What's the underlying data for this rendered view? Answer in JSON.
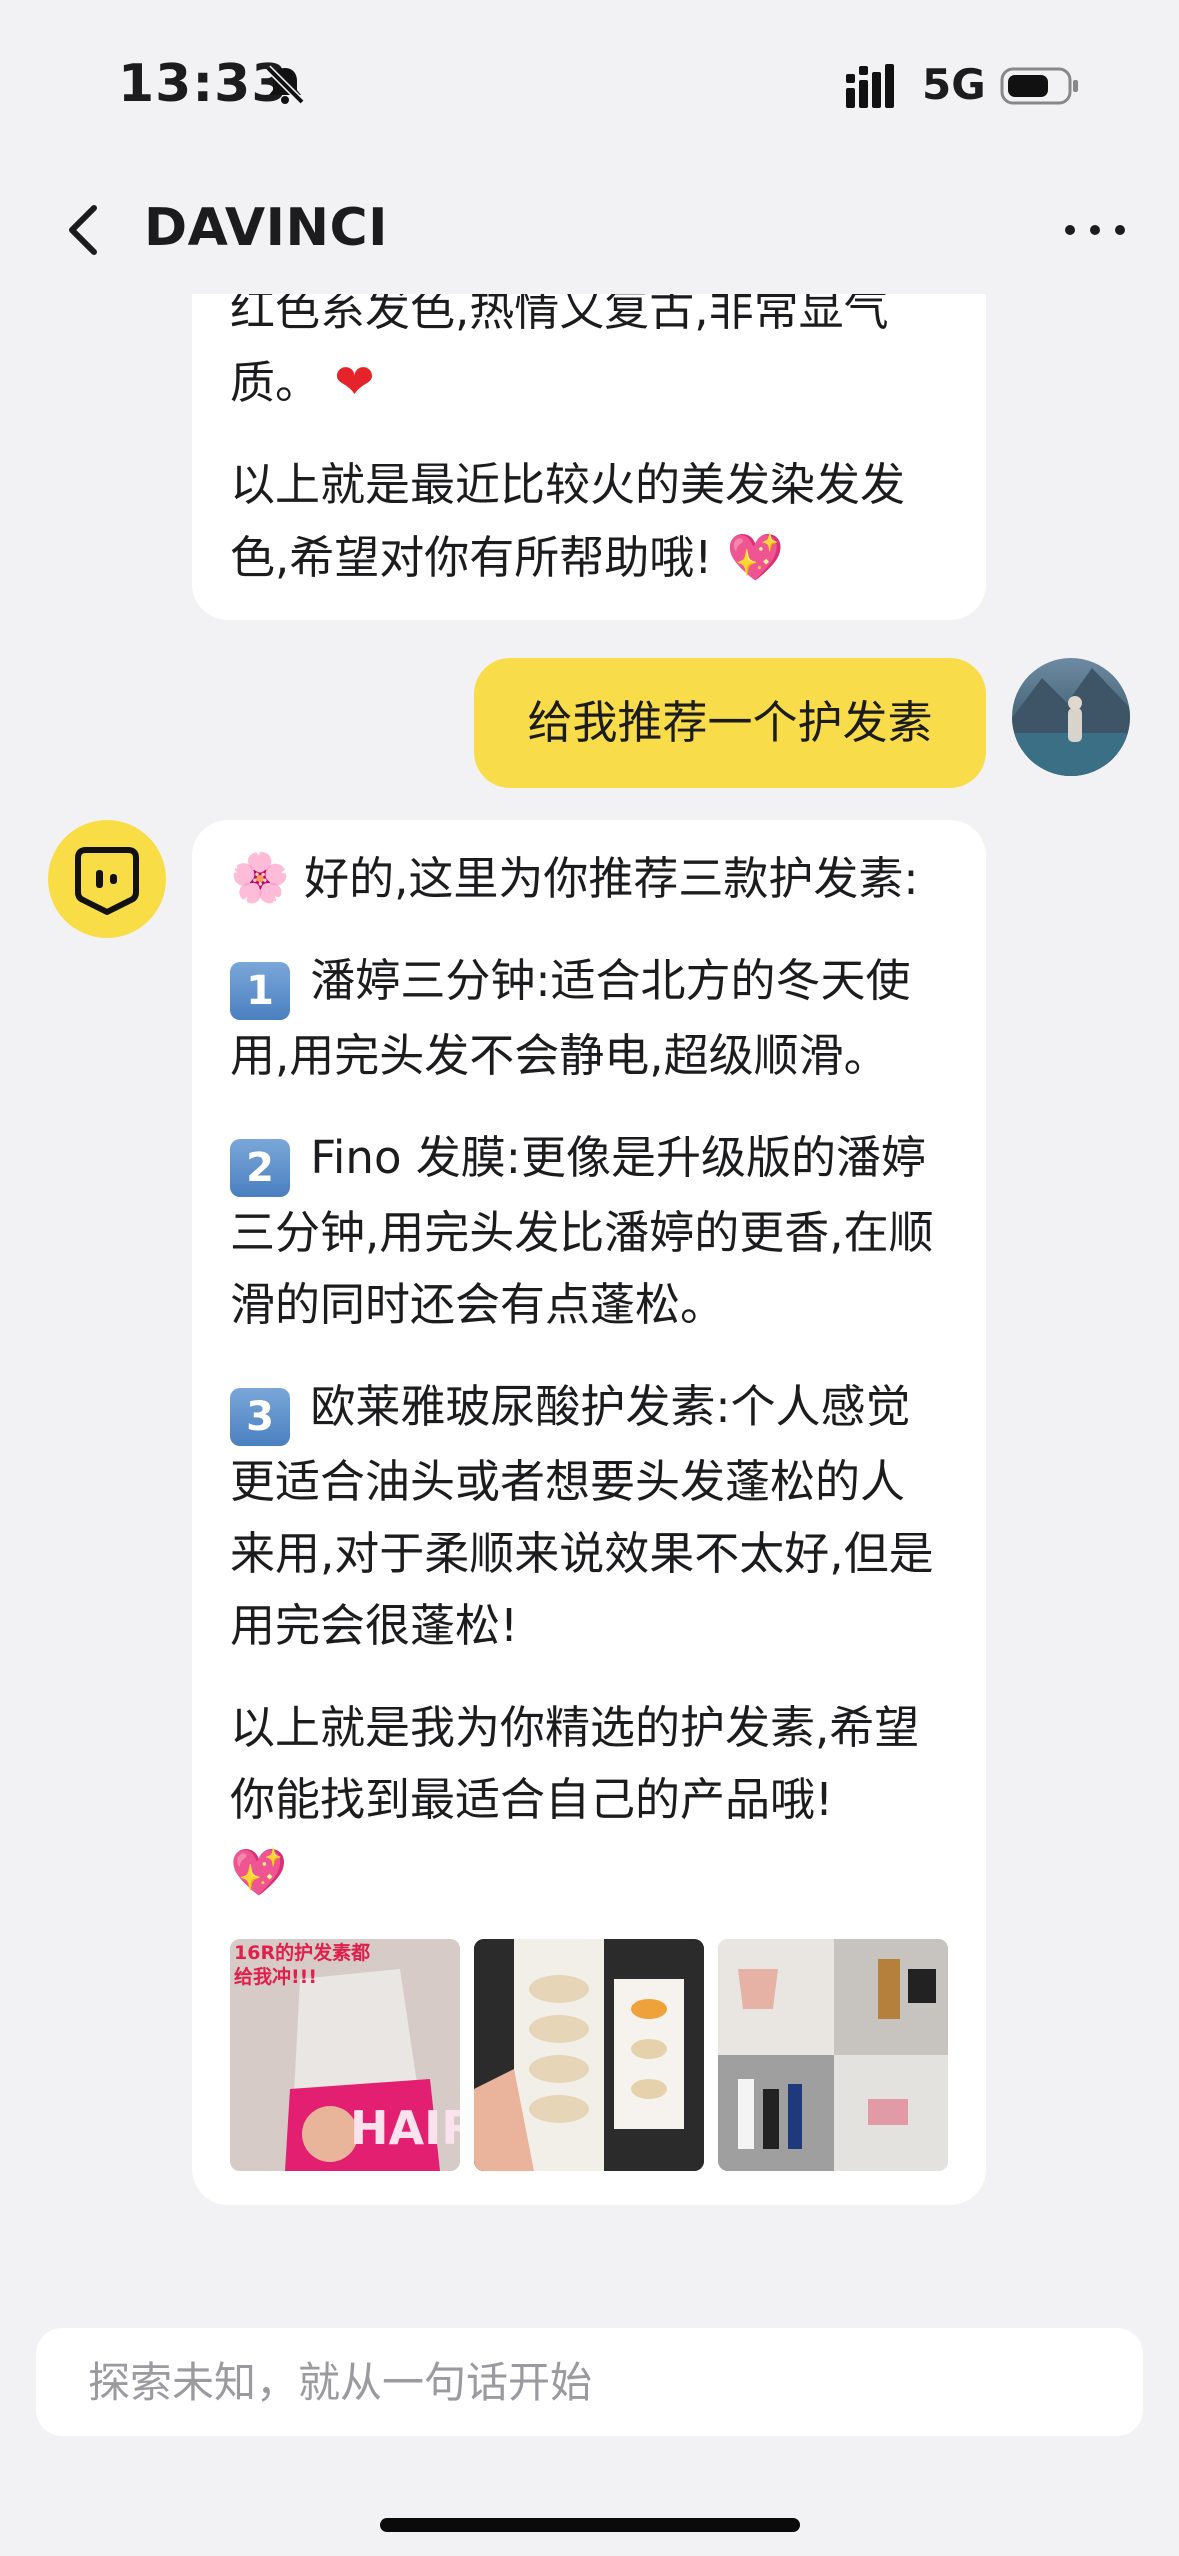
{
  "status_bar": {
    "time": "13:33",
    "network": "5G"
  },
  "header": {
    "title": "DAVINCI"
  },
  "messages": {
    "prev_bot": {
      "p1": "红色系发色,热情又复古,非常显气质。",
      "p1_emoji": "❤",
      "p2": "以上就是最近比较火的美发染发发色,希望对你有所帮助哦!",
      "p2_emoji": "💖"
    },
    "user": {
      "text": "给我推荐一个护发素"
    },
    "bot": {
      "intro_emoji": "🌸",
      "intro": "好的,这里为你推荐三款护发素:",
      "items": [
        {
          "num": "1",
          "text": "潘婷三分钟:适合北方的冬天使用,用完头发不会静电,超级顺滑。"
        },
        {
          "num": "2",
          "text": "Fino 发膜:更像是升级版的潘婷三分钟,用完头发比潘婷的更香,在顺滑的同时还会有点蓬松。"
        },
        {
          "num": "3",
          "text": "欧莱雅玻尿酸护发素:个人感觉更适合油头或者想要头发蓬松的人来用,对于柔顺来说效果不太好,但是用完会很蓬松!"
        }
      ],
      "outro": "以上就是我为你精选的护发素,希望你能找到最适合自己的产品哦!",
      "outro_emoji": "💖",
      "thumbs": [
        {
          "caption": "16R的护发素都给我冲!!!",
          "label": "HAIR"
        },
        {
          "caption": "",
          "label": ""
        },
        {
          "caption": "",
          "label": ""
        }
      ]
    }
  },
  "input": {
    "placeholder": "探索未知，就从一句话开始"
  },
  "colors": {
    "accent": "#f9dc4a",
    "background": "#f2f2f4",
    "bubble": "#ffffff"
  }
}
